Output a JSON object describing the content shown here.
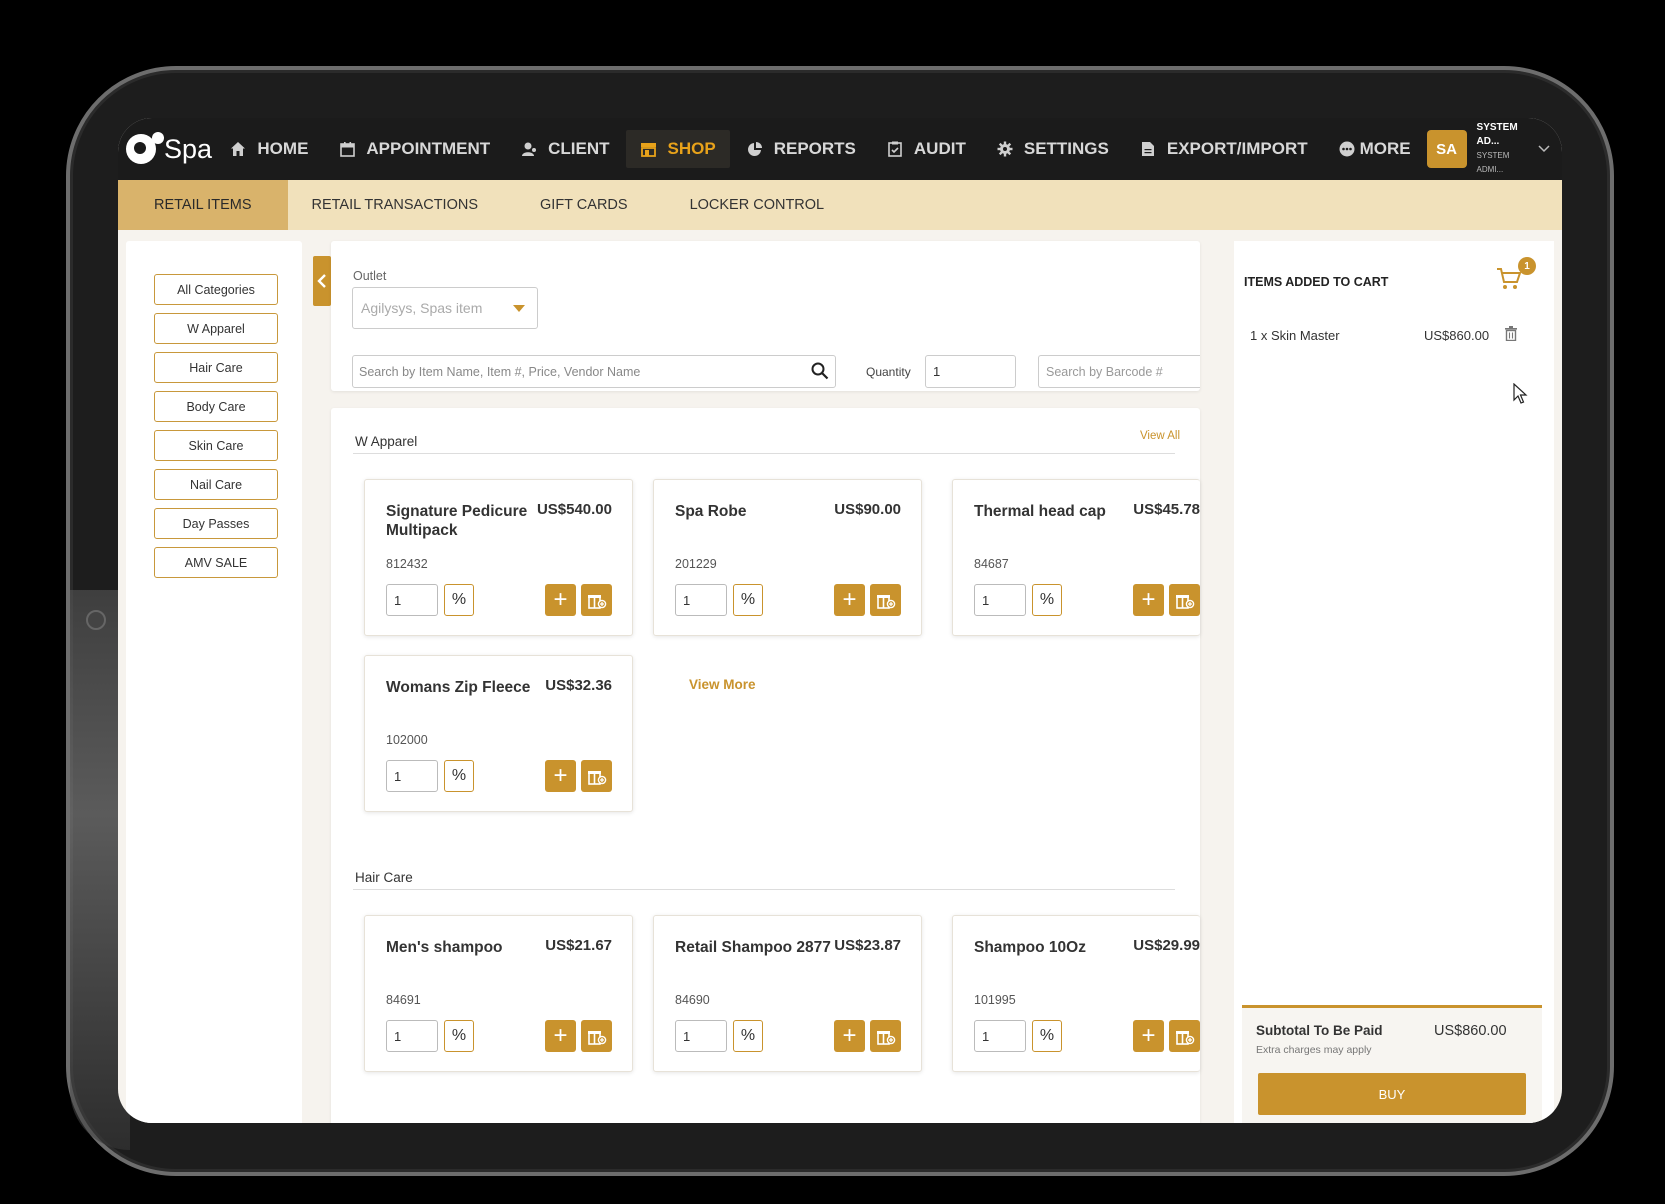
{
  "app": {
    "name": "Spa"
  },
  "nav": {
    "items": [
      {
        "label": "HOME",
        "icon": "home-icon"
      },
      {
        "label": "APPOINTMENT",
        "icon": "calendar-icon"
      },
      {
        "label": "CLIENT",
        "icon": "user-icon"
      },
      {
        "label": "SHOP",
        "icon": "store-icon"
      },
      {
        "label": "REPORTS",
        "icon": "pie-chart-icon"
      },
      {
        "label": "AUDIT",
        "icon": "clipboard-icon"
      },
      {
        "label": "SETTINGS",
        "icon": "gear-icon"
      },
      {
        "label": "EXPORT/IMPORT",
        "icon": "file-icon"
      },
      {
        "label": "MORE",
        "icon": "more-icon"
      }
    ],
    "active": "SHOP"
  },
  "user": {
    "initials": "SA",
    "name": "SYSTEM AD...",
    "role": "SYSTEM ADMI..."
  },
  "subtabs": [
    "RETAIL ITEMS",
    "RETAIL TRANSACTIONS",
    "GIFT CARDS",
    "LOCKER CONTROL"
  ],
  "categories": [
    "All Categories",
    "W Apparel",
    "Hair Care",
    "Body Care",
    "Skin Care",
    "Nail Care",
    "Day Passes",
    "AMV SALE"
  ],
  "search": {
    "outlet_label": "Outlet",
    "outlet_value": "Agilysys, Spas item",
    "item_placeholder": "Search by Item Name, Item #, Price, Vendor Name",
    "quantity_label": "Quantity",
    "quantity_value": "1",
    "barcode_placeholder": "Search by Barcode #"
  },
  "sections": [
    {
      "title": "W Apparel",
      "view_all": "View All",
      "view_more": "View More",
      "items": [
        {
          "name": "Signature Pedicure Multipack",
          "price": "US$540.00",
          "sku": "812432",
          "qty": "1"
        },
        {
          "name": "Spa Robe",
          "price": "US$90.00",
          "sku": "201229",
          "qty": "1"
        },
        {
          "name": "Thermal head cap",
          "price": "US$45.78",
          "sku": "84687",
          "qty": "1"
        },
        {
          "name": "Womans Zip Fleece",
          "price": "US$32.36",
          "sku": "102000",
          "qty": "1"
        }
      ]
    },
    {
      "title": "Hair Care",
      "items": [
        {
          "name": "Men's shampoo",
          "price": "US$21.67",
          "sku": "84691",
          "qty": "1"
        },
        {
          "name": "Retail Shampoo 2877",
          "price": "US$23.87",
          "sku": "84690",
          "qty": "1"
        },
        {
          "name": "Shampoo 10Oz",
          "price": "US$29.99",
          "sku": "101995",
          "qty": "1"
        }
      ]
    }
  ],
  "card_labels": {
    "pct": "%",
    "add": "+"
  },
  "cart": {
    "title": "ITEMS ADDED TO CART",
    "badge": "1",
    "lines": [
      {
        "label": "1 x Skin Master",
        "price": "US$860.00"
      }
    ],
    "subtotal_label": "Subtotal To Be Paid",
    "subtotal_value": "US$860.00",
    "note": "Extra charges may apply",
    "buy_label": "BUY"
  },
  "colors": {
    "accent": "#c9932d",
    "nav_bg": "#1b1b1b",
    "subtab_bg": "#f1e1bb",
    "active_nav": "#e8a21a"
  }
}
